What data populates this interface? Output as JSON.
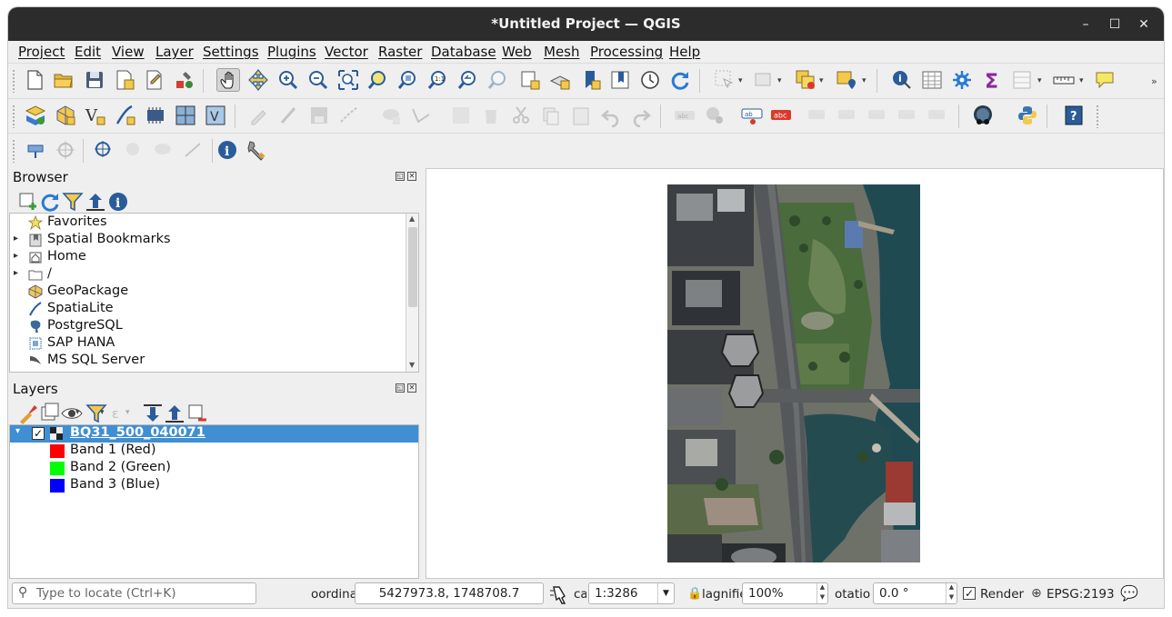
{
  "window": {
    "title": "*Untitled Project — QGIS"
  },
  "menubar": [
    "Project",
    "Edit",
    "View",
    "Layer",
    "Settings",
    "Plugins",
    "Vector",
    "Raster",
    "Database",
    "Web",
    "Mesh",
    "Processing",
    "Help"
  ],
  "browser": {
    "title": "Browser",
    "items": [
      {
        "label": "Favorites",
        "icon": "star-icon",
        "expandable": false
      },
      {
        "label": "Spatial Bookmarks",
        "icon": "bookmark-icon",
        "expandable": true
      },
      {
        "label": "Home",
        "icon": "home-icon",
        "expandable": true
      },
      {
        "label": "/",
        "icon": "folder-icon",
        "expandable": true
      },
      {
        "label": "GeoPackage",
        "icon": "geopackage-icon",
        "expandable": false
      },
      {
        "label": "SpatiaLite",
        "icon": "spatialite-icon",
        "expandable": false
      },
      {
        "label": "PostgreSQL",
        "icon": "postgresql-icon",
        "expandable": false
      },
      {
        "label": "SAP HANA",
        "icon": "sap-hana-icon",
        "expandable": false
      },
      {
        "label": "MS SQL Server",
        "icon": "mssql-icon",
        "expandable": false
      }
    ]
  },
  "layers": {
    "title": "Layers",
    "layer_name": "BQ31_500_040071",
    "checked": true,
    "bands": [
      {
        "label": "Band 1 (Red)",
        "color": "#ff0000"
      },
      {
        "label": "Band 2 (Green)",
        "color": "#00ff00"
      },
      {
        "label": "Band 3 (Blue)",
        "color": "#0000ff"
      }
    ]
  },
  "status": {
    "locate_placeholder": "Type to locate (Ctrl+K)",
    "coordinate_label": "oordinat",
    "coordinate_value": "5427973.8, 1748708.7",
    "scale_label": "cal",
    "scale_value": "1:3286",
    "magnifier_label": "lagnifie",
    "magnifier_value": "100%",
    "rotation_label": "otatio",
    "rotation_value": "0.0 °",
    "render_label": "Render",
    "render_checked": true,
    "crs": "EPSG:2193"
  },
  "colors": {
    "titlebar": "#2c2c2c",
    "selection": "#3f8fd2",
    "accent_yellow": "#f2c94c"
  }
}
